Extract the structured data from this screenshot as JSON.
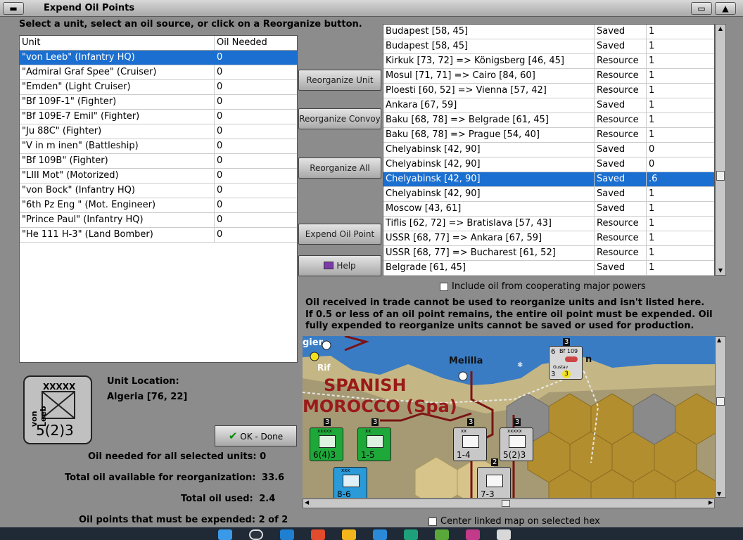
{
  "window": {
    "title": "Expend Oil Points"
  },
  "instruction": "Select a unit, select an oil source, or click on a Reorganize button.",
  "unit_table": {
    "headers": [
      "Unit",
      "Oil Needed"
    ],
    "rows": [
      {
        "unit": "\"von Leeb\" (Infantry HQ)",
        "oil": "0",
        "selected": true
      },
      {
        "unit": "\"Admiral Graf Spee\" (Cruiser)",
        "oil": "0"
      },
      {
        "unit": "\"Emden\" (Light Cruiser)",
        "oil": "0"
      },
      {
        "unit": "\"Bf 109F-1\" (Fighter)",
        "oil": "0"
      },
      {
        "unit": "\"Bf 109E-7 Emil\" (Fighter)",
        "oil": "0"
      },
      {
        "unit": "\"Ju 88C\" (Fighter)",
        "oil": "0"
      },
      {
        "unit": "\"V in m inen\" (Battleship)",
        "oil": "0"
      },
      {
        "unit": "\"Bf 109B\" (Fighter)",
        "oil": "0"
      },
      {
        "unit": "\"LIII Mot\" (Motorized)",
        "oil": "0"
      },
      {
        "unit": "\"von Bock\" (Infantry HQ)",
        "oil": "0"
      },
      {
        "unit": "\"6th Pz Eng \" (Mot. Engineer)",
        "oil": "0"
      },
      {
        "unit": "\"Prince Paul\" (Infantry HQ)",
        "oil": "0"
      },
      {
        "unit": "\"He 111 H-3\" (Land Bomber)",
        "oil": "0"
      }
    ]
  },
  "buttons": {
    "reorganize_unit": "Reorganize Unit",
    "reorganize_convoy": "Reorganize Convoy",
    "reorganize_all": "Reorganize All",
    "expend_oil_point": "Expend Oil Point",
    "help": "Help",
    "ok_done": "OK - Done"
  },
  "source_list": [
    {
      "loc": "Budapest [58, 45]",
      "type": "Saved",
      "amt": "1"
    },
    {
      "loc": "Budapest [58, 45]",
      "type": "Saved",
      "amt": "1"
    },
    {
      "loc": "Kirkuk [73, 72] => Königsberg [46, 45]",
      "type": "Resource",
      "amt": "1"
    },
    {
      "loc": "Mosul [71, 71] => Cairo [84, 60]",
      "type": "Resource",
      "amt": "1"
    },
    {
      "loc": "Ploesti [60, 52] => Vienna [57, 42]",
      "type": "Resource",
      "amt": "1"
    },
    {
      "loc": "Ankara [67, 59]",
      "type": "Saved",
      "amt": "1"
    },
    {
      "loc": "Baku [68, 78] => Belgrade [61, 45]",
      "type": "Resource",
      "amt": "1"
    },
    {
      "loc": "Baku [68, 78] => Prague [54, 40]",
      "type": "Resource",
      "amt": "1"
    },
    {
      "loc": "Chelyabinsk [42, 90]",
      "type": "Saved",
      "amt": "0"
    },
    {
      "loc": "Chelyabinsk [42, 90]",
      "type": "Saved",
      "amt": "0"
    },
    {
      "loc": "Chelyabinsk [42, 90]",
      "type": "Saved",
      "amt": ".6",
      "selected": true
    },
    {
      "loc": "Chelyabinsk [42, 90]",
      "type": "Saved",
      "amt": "1"
    },
    {
      "loc": "Moscow [43, 61]",
      "type": "Saved",
      "amt": "1"
    },
    {
      "loc": "Tiflis [62, 72] => Bratislava [57, 43]",
      "type": "Resource",
      "amt": "1"
    },
    {
      "loc": "USSR [68, 77] => Ankara [67, 59]",
      "type": "Resource",
      "amt": "1"
    },
    {
      "loc": "USSR [68, 77] => Bucharest [61, 52]",
      "type": "Resource",
      "amt": "1"
    },
    {
      "loc": "Belgrade [61, 45]",
      "type": "Saved",
      "amt": "1"
    }
  ],
  "include_coop_label": "Include oil from cooperating major powers",
  "note": "Oil received in trade cannot be used to reorganize units and isn't listed here.  If 0.5 or less of an oil point remains, the entire oil point must be expended.   Oil fully expended to reorganize units cannot be saved or used for production.",
  "map": {
    "labels": {
      "gier": "gier",
      "rif": "Rif",
      "melilla": "Melilla",
      "spanish": "SPANISH",
      "morocco": "MOROCCO (Spa)",
      "n": "n"
    },
    "counters": [
      {
        "id": "c1",
        "size": "xxxxx",
        "str": "6(4)3",
        "bg": "#1fa83a"
      },
      {
        "id": "c2",
        "size": "xx",
        "str": "1-5",
        "bg": "#1fa83a"
      },
      {
        "id": "c3",
        "size": "xx",
        "str": "1-4",
        "bg": "#c8c8c8"
      },
      {
        "id": "c4",
        "size": "xxxxx",
        "str": "5(2)3",
        "bg": "#c8c8c8"
      },
      {
        "id": "c5",
        "size": "xxx",
        "str": "8-6",
        "bg": "#2a9ad8"
      },
      {
        "id": "c6",
        "size": "",
        "str": "7-3",
        "bg": "#c8c8c8"
      }
    ],
    "stack_numbers": [
      "3",
      "3",
      "3",
      "3",
      "2",
      "3"
    ],
    "air": {
      "name": "Bf 109",
      "sub": "Gustav",
      "top": "6",
      "bot": "3",
      "badge": "3"
    }
  },
  "selected_unit": {
    "size": "XXXXX",
    "name": "von Leeb",
    "strength": "5(2)3",
    "location_label": "Unit Location:",
    "location": "Algeria [76, 22]"
  },
  "stats": {
    "oil_needed": {
      "label": "Oil needed for all selected units:",
      "value": "0"
    },
    "total_available": {
      "label": "Total oil available for reorganization:",
      "value": "33.6"
    },
    "total_used": {
      "label": "Total oil used:",
      "value": "2.4"
    },
    "must_expend": {
      "label": "Oil points that must be expended:",
      "value": "2 of 2"
    }
  },
  "center_linked_label": "Center linked map on selected hex",
  "colors": {
    "selection": "#1b6fd0",
    "spanish_text": "#9a1a1a"
  }
}
